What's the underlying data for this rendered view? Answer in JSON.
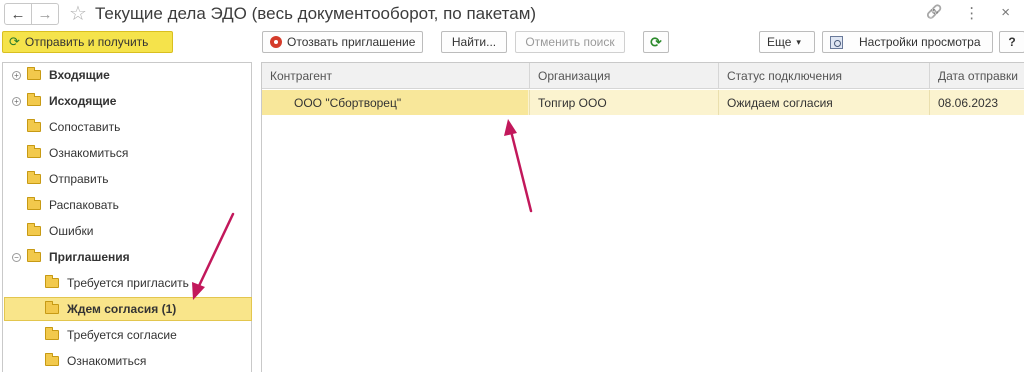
{
  "window": {
    "title": "Текущие дела ЭДО (весь документооборот, по пакетам)",
    "back_icon": "←",
    "forward_icon": "→",
    "star_icon": "☆",
    "link_icon": "🔗",
    "menu_icon": "⋮",
    "close_icon": "×"
  },
  "toolbar": {
    "send_receive": "Отправить и получить",
    "recall_invitation": "Отозвать приглашение",
    "find": "Найти...",
    "cancel_search": "Отменить поиск",
    "refresh_icon": "⟳",
    "more": "Еще",
    "more_arrow": "▾",
    "view_settings": "Настройки просмотра",
    "help": "?"
  },
  "tree": {
    "items": [
      {
        "label": "Входящие",
        "bold": true,
        "toggle": "+"
      },
      {
        "label": "Исходящие",
        "bold": true,
        "toggle": "+"
      },
      {
        "label": "Сопоставить"
      },
      {
        "label": "Ознакомиться"
      },
      {
        "label": "Отправить"
      },
      {
        "label": "Распаковать"
      },
      {
        "label": "Ошибки"
      },
      {
        "label": "Приглашения",
        "bold": true,
        "toggle": "−"
      },
      {
        "label": "Требуется пригласить"
      },
      {
        "label": "Ждем согласия (1)",
        "bold": true,
        "selected": true
      },
      {
        "label": "Требуется согласие"
      },
      {
        "label": "Ознакомиться"
      }
    ]
  },
  "table": {
    "columns": [
      "Контрагент",
      "Организация",
      "Статус подключения",
      "Дата отправки"
    ],
    "rows": [
      [
        "ООО \"Сбортворец\"",
        "Топгир ООО",
        "Ожидаем согласия",
        "08.06.2023"
      ]
    ]
  },
  "colors": {
    "accent_yellow": "#f5e34b",
    "selection": "#f9e58a",
    "arrow": "#c2185b"
  }
}
